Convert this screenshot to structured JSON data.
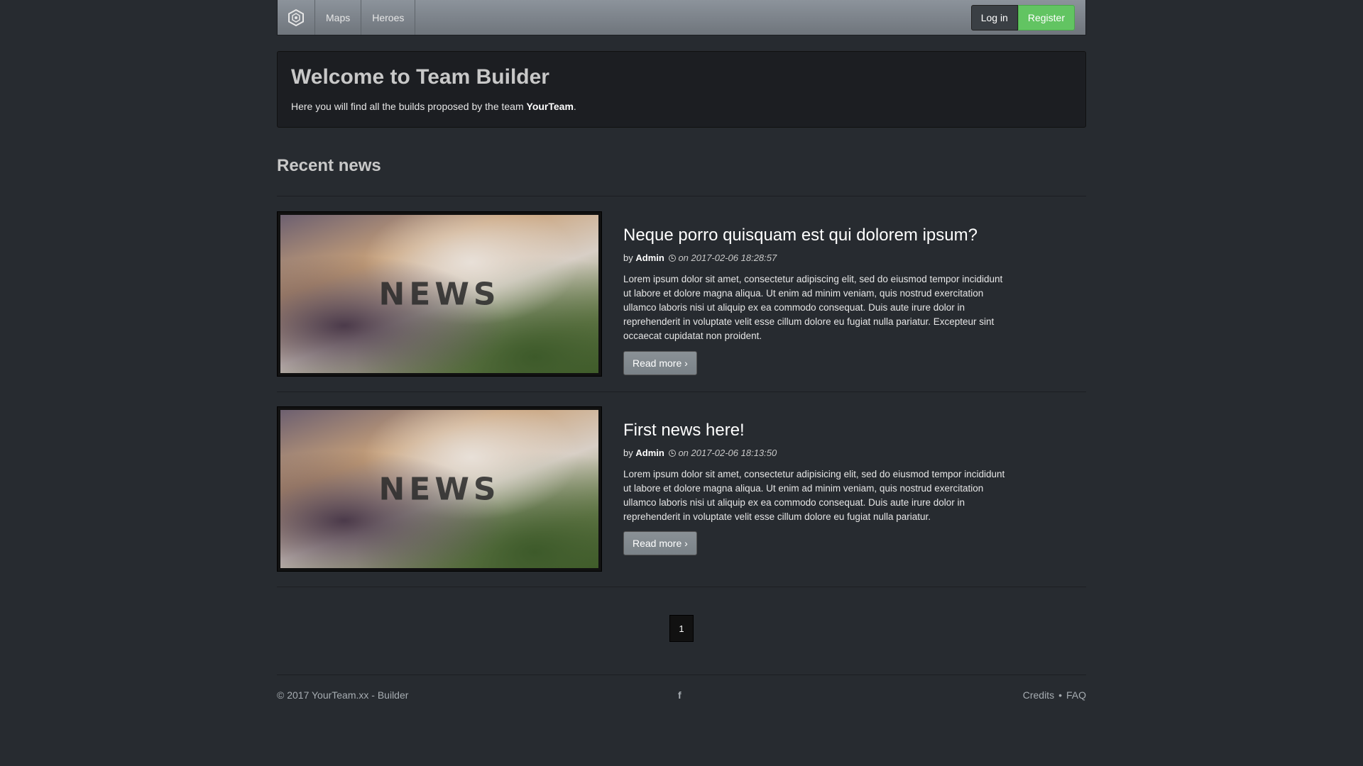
{
  "nav": {
    "brand_icon": "hexagon-logo-icon",
    "links": [
      "Maps",
      "Heroes"
    ],
    "login": "Log in",
    "register": "Register"
  },
  "jumbotron": {
    "title": "Welcome to Team Builder",
    "text_prefix": "Here you will find all the builds proposed by the team",
    "team_name": "YourTeam",
    "text_suffix": "."
  },
  "section_title": "Recent news",
  "news": [
    {
      "image_text": "NEWS",
      "title": "Neque porro quisquam est qui dolorem ipsum?",
      "by": "by",
      "author": "Admin",
      "date": "on 2017-02-06 18:28:57",
      "text": "Lorem ipsum dolor sit amet, consectetur adipiscing elit, sed do eiusmod tempor incididunt ut labore et dolore magna aliqua. Ut enim ad minim veniam, quis nostrud exercitation ullamco laboris nisi ut aliquip ex ea commodo consequat. Duis aute irure dolor in reprehenderit in voluptate velit esse cillum dolore eu fugiat nulla pariatur. Excepteur sint occaecat cupidatat non proident.",
      "read_more": "Read more ›"
    },
    {
      "image_text": "NEWS",
      "title": "First news here!",
      "by": "by",
      "author": "Admin",
      "date": "on 2017-02-06 18:13:50",
      "text": "Lorem ipsum dolor sit amet, consectetur adipisicing elit, sed do eiusmod tempor incididunt ut labore et dolore magna aliqua. Ut enim ad minim veniam, quis nostrud exercitation ullamco laboris nisi ut aliquip ex ea commodo consequat. Duis aute irure dolor in reprehenderit in voluptate velit esse cillum dolore eu fugiat nulla pariatur.",
      "read_more": "Read more ›"
    }
  ],
  "pagination": {
    "current": "1"
  },
  "footer": {
    "copyright": "© 2017 YourTeam.xx - Builder",
    "social_icon": "facebook-icon",
    "social_glyph": "f",
    "credits": "Credits",
    "separator": "•",
    "faq": "FAQ"
  }
}
